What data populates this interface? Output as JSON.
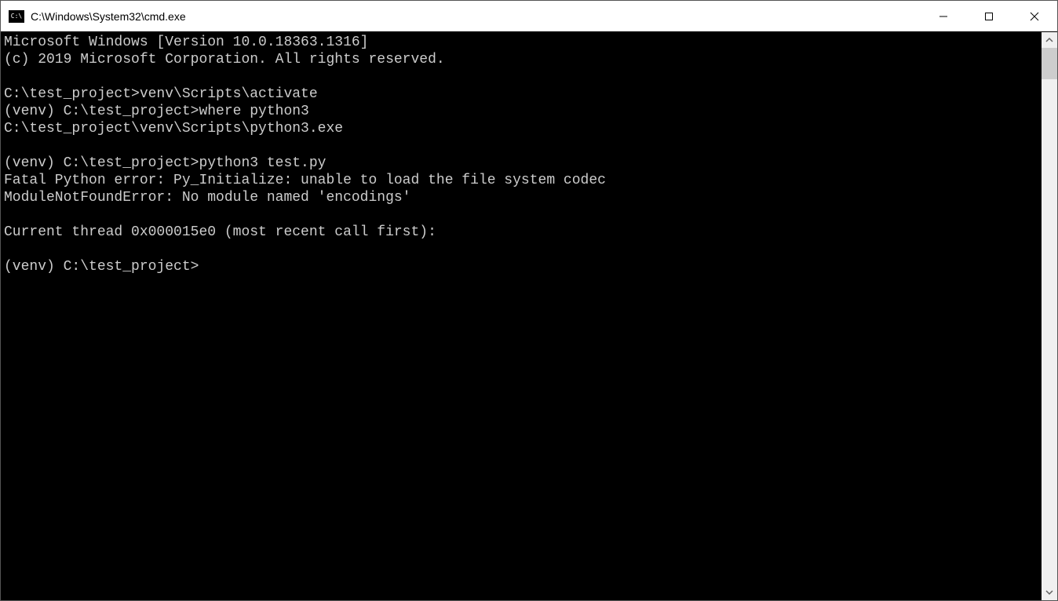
{
  "window": {
    "title": "C:\\Windows\\System32\\cmd.exe"
  },
  "terminal": {
    "lines": [
      "Microsoft Windows [Version 10.0.18363.1316]",
      "(c) 2019 Microsoft Corporation. All rights reserved.",
      "",
      "C:\\test_project>venv\\Scripts\\activate",
      "(venv) C:\\test_project>where python3",
      "C:\\test_project\\venv\\Scripts\\python3.exe",
      "",
      "(venv) C:\\test_project>python3 test.py",
      "Fatal Python error: Py_Initialize: unable to load the file system codec",
      "ModuleNotFoundError: No module named 'encodings'",
      "",
      "Current thread 0x000015e0 (most recent call first):",
      "",
      "(venv) C:\\test_project>"
    ]
  }
}
